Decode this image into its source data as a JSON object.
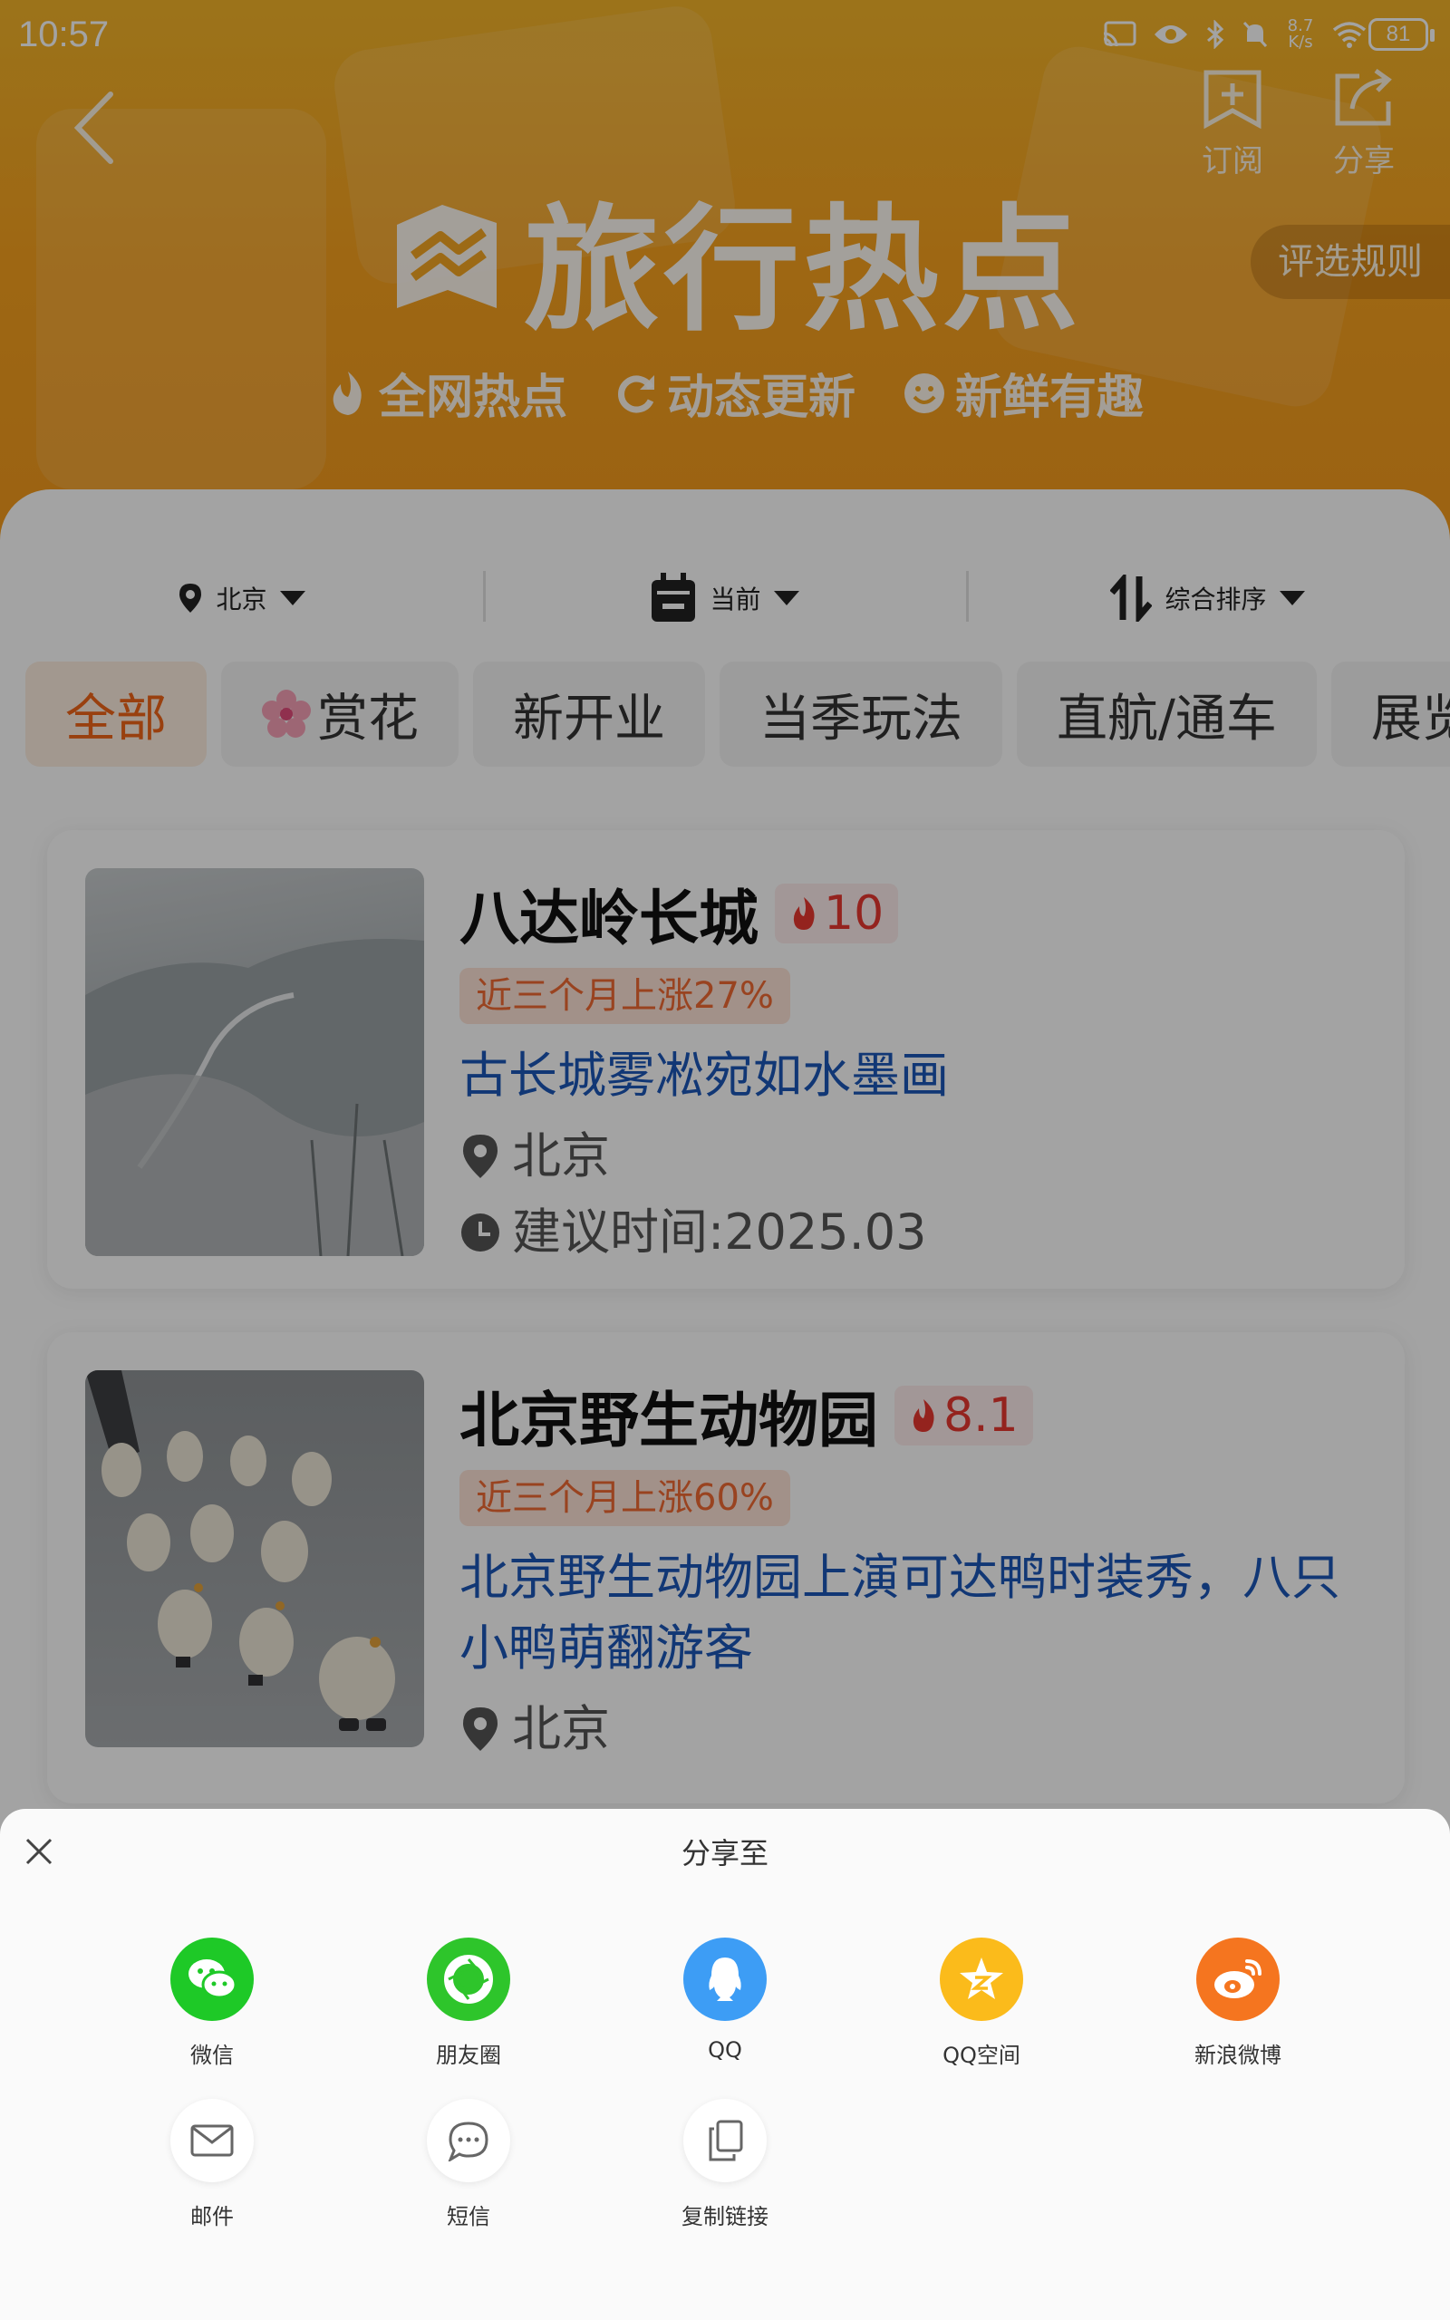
{
  "status_bar": {
    "time": "10:57",
    "speed_value": "8.7",
    "speed_unit": "K/s",
    "battery": "81"
  },
  "header": {
    "title": "旅行热点",
    "subscribe_label": "订阅",
    "share_label": "分享",
    "rules_label": "评选规则",
    "features": [
      "全网热点",
      "动态更新",
      "新鲜有趣"
    ]
  },
  "filters": {
    "city": "北京",
    "time": "当前",
    "sort": "综合排序"
  },
  "categories": [
    "全部",
    "赏花",
    "新开业",
    "当季玩法",
    "直航/通车",
    "展览"
  ],
  "cards": [
    {
      "title": "八达岭长城",
      "heat": "10",
      "rise": "近三个月上涨27%",
      "desc": "古长城雾凇宛如水墨画",
      "location": "北京",
      "suggest": "建议时间:2025.03"
    },
    {
      "title": "北京野生动物园",
      "heat": "8.1",
      "rise": "近三个月上涨60%",
      "desc": "北京野生动物园上演可达鸭时装秀，八只小鸭萌翻游客",
      "location": "北京"
    }
  ],
  "share_sheet": {
    "title": "分享至",
    "items": [
      {
        "label": "微信",
        "icon": "wechat-icon",
        "color": "#1ec927"
      },
      {
        "label": "朋友圈",
        "icon": "moments-icon",
        "color": "#2ec52b"
      },
      {
        "label": "QQ",
        "icon": "qq-icon",
        "color": "#3d9df5"
      },
      {
        "label": "QQ空间",
        "icon": "qzone-icon",
        "color": "#fbbb1b"
      },
      {
        "label": "新浪微博",
        "icon": "weibo-icon",
        "color": "#f5751f"
      },
      {
        "label": "邮件",
        "icon": "mail-icon",
        "color": "#ffffff"
      },
      {
        "label": "短信",
        "icon": "sms-icon",
        "color": "#ffffff"
      },
      {
        "label": "复制链接",
        "icon": "copy-link-icon",
        "color": "#ffffff"
      }
    ]
  }
}
